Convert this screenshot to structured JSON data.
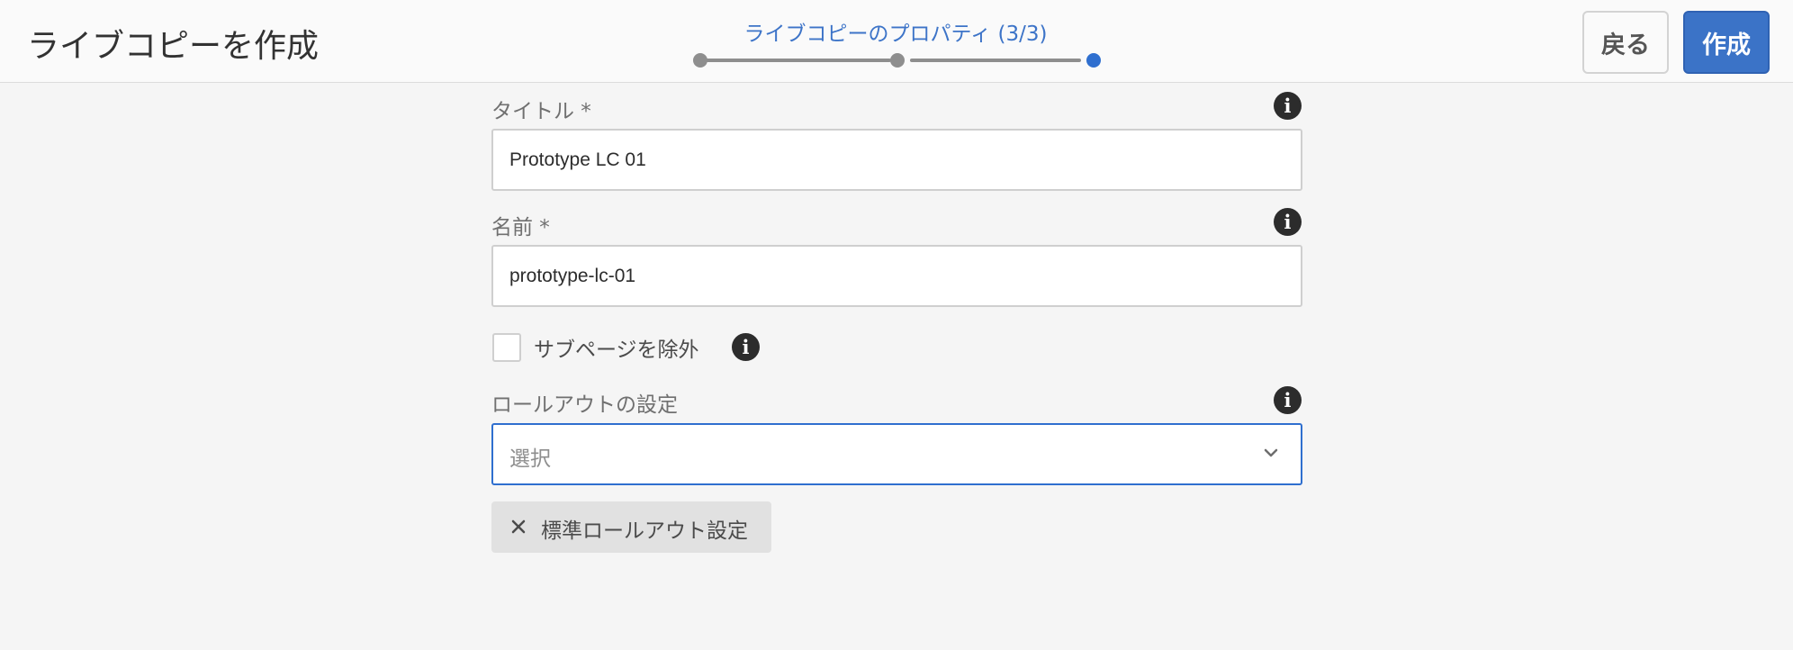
{
  "header": {
    "title": "ライブコピーを作成",
    "wizard": {
      "step_label": "ライブコピーのプロパティ (3/3)",
      "current_step": 3,
      "total_steps": 3,
      "accent_color": "#2f6fcf"
    },
    "back_label": "戻る",
    "create_label": "作成"
  },
  "form": {
    "title_field": {
      "label": "タイトル *",
      "value": "Prototype LC 01",
      "info_icon": "info-icon"
    },
    "name_field": {
      "label": "名前 *",
      "value": "prototype-lc-01",
      "info_icon": "info-icon"
    },
    "exclude_subpages": {
      "label": "サブページを除外",
      "checked": false,
      "info_icon": "info-icon"
    },
    "rollout_config": {
      "label": "ロールアウトの設定",
      "placeholder": "選択",
      "info_icon": "info-icon",
      "selected_tags": [
        {
          "label": "標準ロールアウト設定"
        }
      ]
    }
  }
}
